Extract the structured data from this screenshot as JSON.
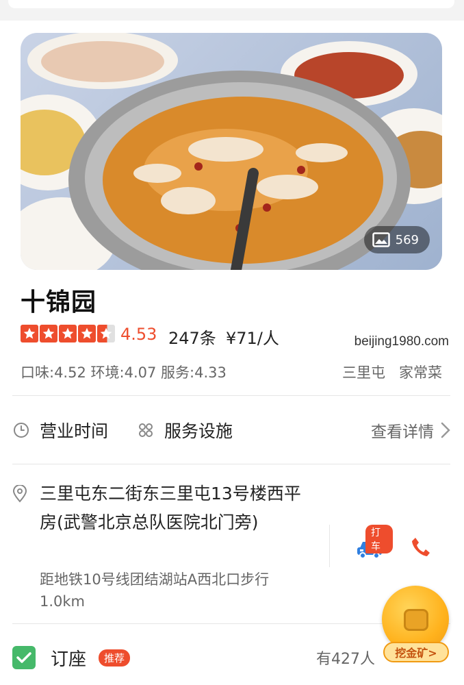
{
  "header": {
    "search_placeholder": ""
  },
  "photo": {
    "count": "569",
    "alt": ""
  },
  "restaurant": {
    "name": "十锦园",
    "rating_value": 4.53,
    "score": "4.53",
    "reviews": "247条",
    "price": "¥71/人",
    "watermark": "beijing1980.com",
    "subscores": "口味:4.52 环境:4.07 服务:4.33",
    "tags": [
      "三里屯",
      "家常菜"
    ]
  },
  "info": {
    "hours_label": "营业时间",
    "facilities_label": "服务设施",
    "detail_link": "查看详情"
  },
  "address": {
    "text": "三里屯东二街东三里屯13号楼西平房(武警北京总队医院北门旁)",
    "metro": "距地铁10号线团结湖站A西北口步行1.0km",
    "taxi_badge": "打车"
  },
  "booking": {
    "label": "订座",
    "badge": "推荐",
    "booked_text": "有427人"
  },
  "gold_mine": {
    "label": "挖金矿>"
  },
  "colors": {
    "accent": "#ee4d2d",
    "taxi_blue": "#2f7fe0",
    "check_green": "#46b96a",
    "gold": "#ffb21d"
  },
  "icons": [
    "clock-icon",
    "services-grid-icon",
    "chevron-right-icon",
    "location-pin-icon",
    "taxi-car-icon",
    "phone-icon",
    "check-icon",
    "image-icon",
    "star-icon"
  ]
}
